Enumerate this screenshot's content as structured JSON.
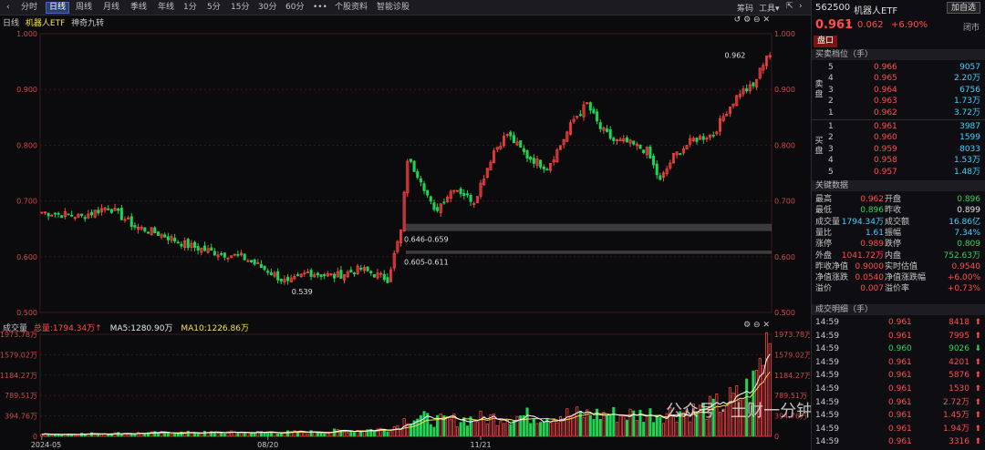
{
  "toolbar": {
    "back_icon": "chevron-left-icon",
    "tabs": [
      "分时",
      "日线",
      "周线",
      "月线",
      "季线",
      "年线",
      "1分",
      "5分",
      "15分",
      "30分",
      "60分",
      "•••",
      "个股资料",
      "智能诊股"
    ],
    "active_tab": "日线",
    "right_items": [
      "筹码",
      "工具▾"
    ],
    "colors": {
      "active": "#2a3f78"
    }
  },
  "chart": {
    "label_period": "日线",
    "label_name": "机器人ETF",
    "label_indicator": "神奇九转",
    "price_annotations": {
      "high_marker": "0.962",
      "low_marker": "0.539"
    },
    "range_boxes": [
      {
        "label": "0.646-0.659",
        "low": 0.646,
        "high": 0.659
      },
      {
        "label": "0.605-0.611",
        "low": 0.605,
        "high": 0.611
      }
    ],
    "volume_legend": {
      "name": "成交量",
      "total": "总量:1794.34万↑",
      "ma5": "MA5:1280.90万",
      "ma10": "MA10:1226.86万"
    },
    "date_labels": [
      {
        "text": "2024-05",
        "index": 0
      },
      {
        "text": "08/20",
        "index": 68
      },
      {
        "text": "11/21",
        "index": 132
      }
    ],
    "watermark": "公众号 · 土财一分钟",
    "colors": {
      "up": "#ff4242",
      "down": "#1fd455",
      "ma5": "#ffffff",
      "ma10": "#f5e04a",
      "bg": "#0b0b0e"
    }
  },
  "chart_data": {
    "type": "bar",
    "price_axis": {
      "ticks": [
        "1.000",
        "0.900",
        "0.800",
        "0.700",
        "0.600",
        "0.500"
      ],
      "min": 0.5,
      "max": 1.0
    },
    "volume_axis": {
      "ticks": [
        "1973.78万",
        "1579.02万",
        "1184.27万",
        "789.51万",
        "394.76万",
        "0"
      ],
      "max": 1973.78
    },
    "x_labels": [
      "2024-05",
      "08/20",
      "11/21"
    ],
    "ohlc_anchor_points": [
      [
        0,
        0.68
      ],
      [
        12,
        0.672
      ],
      [
        20,
        0.69
      ],
      [
        28,
        0.654
      ],
      [
        36,
        0.64
      ],
      [
        44,
        0.62
      ],
      [
        52,
        0.608
      ],
      [
        60,
        0.6
      ],
      [
        68,
        0.575
      ],
      [
        74,
        0.552
      ],
      [
        80,
        0.572
      ],
      [
        88,
        0.565
      ],
      [
        96,
        0.578
      ],
      [
        104,
        0.56
      ],
      [
        108,
        0.646
      ],
      [
        110,
        0.775
      ],
      [
        114,
        0.74
      ],
      [
        118,
        0.68
      ],
      [
        124,
        0.725
      ],
      [
        130,
        0.7
      ],
      [
        136,
        0.79
      ],
      [
        140,
        0.82
      ],
      [
        146,
        0.78
      ],
      [
        152,
        0.76
      ],
      [
        156,
        0.8
      ],
      [
        160,
        0.846
      ],
      [
        164,
        0.874
      ],
      [
        168,
        0.83
      ],
      [
        172,
        0.808
      ],
      [
        176,
        0.805
      ],
      [
        182,
        0.79
      ],
      [
        186,
        0.735
      ],
      [
        190,
        0.78
      ],
      [
        196,
        0.81
      ],
      [
        202,
        0.82
      ],
      [
        206,
        0.862
      ],
      [
        210,
        0.895
      ],
      [
        214,
        0.905
      ],
      [
        218,
        0.962
      ]
    ],
    "volume_anchor_points": [
      [
        0,
        40
      ],
      [
        40,
        70
      ],
      [
        80,
        80
      ],
      [
        104,
        140
      ],
      [
        108,
        240
      ],
      [
        110,
        380
      ],
      [
        120,
        300
      ],
      [
        140,
        380
      ],
      [
        160,
        420
      ],
      [
        180,
        420
      ],
      [
        200,
        520
      ],
      [
        210,
        760
      ],
      [
        214,
        1000
      ],
      [
        218,
        1794.34
      ]
    ]
  },
  "quote": {
    "code": "562500",
    "name": "机器人ETF",
    "add_button": "加自选",
    "price": "0.961",
    "arrow": "⬆",
    "change": "0.062",
    "pct": "+6.90%",
    "state": "闭市",
    "tab": "盘口"
  },
  "orderbook": {
    "title": "买卖档位（手）",
    "sell_label": "卖盘",
    "buy_label": "买盘",
    "sells": [
      {
        "lv": "5",
        "price": "0.966",
        "vol": "9057"
      },
      {
        "lv": "4",
        "price": "0.965",
        "vol": "2.20万"
      },
      {
        "lv": "3",
        "price": "0.964",
        "vol": "6756"
      },
      {
        "lv": "2",
        "price": "0.963",
        "vol": "1.73万"
      },
      {
        "lv": "1",
        "price": "0.962",
        "vol": "3.72万"
      }
    ],
    "buys": [
      {
        "lv": "1",
        "price": "0.961",
        "vol": "3987"
      },
      {
        "lv": "2",
        "price": "0.960",
        "vol": "1599"
      },
      {
        "lv": "3",
        "price": "0.959",
        "vol": "8033"
      },
      {
        "lv": "4",
        "price": "0.958",
        "vol": "1.53万"
      },
      {
        "lv": "5",
        "price": "0.957",
        "vol": "1.48万"
      }
    ]
  },
  "stats": {
    "title": "关键数据",
    "rows": [
      {
        "k1": "最高",
        "v1": "0.962",
        "c1": "red",
        "k2": "开盘",
        "v2": "0.896",
        "c2": "green"
      },
      {
        "k1": "最低",
        "v1": "0.896",
        "c1": "green",
        "k2": "昨收",
        "v2": "0.899",
        "c2": "white"
      },
      {
        "k1": "成交量",
        "v1": "1794.34万",
        "c1": "cyan",
        "k2": "成交额",
        "v2": "16.86亿",
        "c2": "cyan"
      },
      {
        "k1": "量比",
        "v1": "1.61",
        "c1": "cyan",
        "k2": "振幅",
        "v2": "7.34%",
        "c2": "cyan"
      },
      {
        "k1": "涨停",
        "v1": "0.989",
        "c1": "red",
        "k2": "跌停",
        "v2": "0.809",
        "c2": "green"
      },
      {
        "k1": "外盘",
        "v1": "1041.72万",
        "c1": "red",
        "k2": "内盘",
        "v2": "752.63万",
        "c2": "green"
      },
      {
        "k1": "昨收净值",
        "v1": "0.9000",
        "c1": "red",
        "k2": "实时估值",
        "v2": "0.9540",
        "c2": "red"
      },
      {
        "k1": "净值涨跌",
        "v1": "0.0540",
        "c1": "red",
        "k2": "净值涨跌幅",
        "v2": "+6.00%",
        "c2": "red"
      },
      {
        "k1": "溢价",
        "v1": "0.007",
        "c1": "red",
        "k2": "溢价率",
        "v2": "+0.73%",
        "c2": "red"
      }
    ]
  },
  "trades": {
    "title": "成交明细（手）",
    "rows": [
      {
        "time": "14:59",
        "price": "0.961",
        "pc": "red",
        "vol": "8418",
        "dir": "up"
      },
      {
        "time": "14:59",
        "price": "0.961",
        "pc": "red",
        "vol": "7995",
        "dir": "up"
      },
      {
        "time": "14:59",
        "price": "0.960",
        "pc": "green",
        "vol": "9026",
        "dir": "down"
      },
      {
        "time": "14:59",
        "price": "0.961",
        "pc": "red",
        "vol": "4201",
        "dir": "up"
      },
      {
        "time": "14:59",
        "price": "0.961",
        "pc": "red",
        "vol": "5876",
        "dir": "up"
      },
      {
        "time": "14:59",
        "price": "0.961",
        "pc": "red",
        "vol": "1530",
        "dir": "up"
      },
      {
        "time": "14:59",
        "price": "0.961",
        "pc": "red",
        "vol": "2.72万",
        "dir": "up"
      },
      {
        "time": "14:59",
        "price": "0.961",
        "pc": "red",
        "vol": "1.45万",
        "dir": "up"
      },
      {
        "time": "14:59",
        "price": "0.961",
        "pc": "red",
        "vol": "1.94万",
        "dir": "up"
      },
      {
        "time": "14:59",
        "price": "0.961",
        "pc": "red",
        "vol": "3316",
        "dir": "up"
      }
    ]
  }
}
